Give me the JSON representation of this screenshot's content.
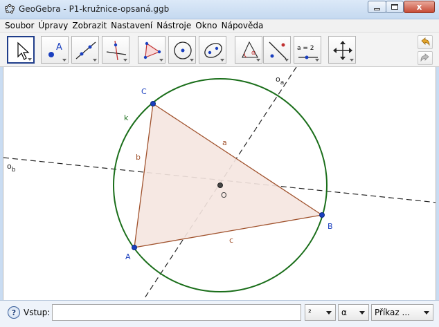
{
  "window": {
    "title": "GeoGebra - P1-kružnice-opsaná.ggb",
    "close_glyph": "x"
  },
  "menu": [
    "Soubor",
    "Úpravy",
    "Zobrazit",
    "Nastavení",
    "Nástroje",
    "Okno",
    "Nápověda"
  ],
  "toolbar": {
    "tools": [
      {
        "name": "move-tool",
        "icon": "cursor-arrow-icon",
        "active": true
      },
      {
        "name": "point-tool",
        "icon": "point-a-icon",
        "active": false
      },
      {
        "name": "line-tool",
        "icon": "line-icon",
        "active": false
      },
      {
        "name": "perpendicular-line-tool",
        "icon": "perpendicular-line-icon",
        "active": false
      },
      {
        "name": "polygon-tool",
        "icon": "polygon-icon",
        "active": false
      },
      {
        "name": "circle-center-point-tool",
        "icon": "circle-center-icon",
        "active": false
      },
      {
        "name": "conic-tool",
        "icon": "ellipse-icon",
        "active": false
      },
      {
        "name": "angle-tool",
        "icon": "angle-icon",
        "active": false
      },
      {
        "name": "reflect-tool",
        "icon": "reflect-icon",
        "active": false
      },
      {
        "name": "slider-tool",
        "icon": "slider-icon",
        "label": "a = 2",
        "active": false
      },
      {
        "name": "move-graphics-tool",
        "icon": "move-cross-icon",
        "active": false
      }
    ],
    "undo_icon": "undo-icon",
    "redo_icon": "redo-icon"
  },
  "canvas": {
    "labels": {
      "A": "A",
      "B": "B",
      "C": "C",
      "O": "O",
      "a": "a",
      "b": "b",
      "c": "c",
      "k": "k",
      "oa_main": "o",
      "oa_sub": "a",
      "ob_main": "o",
      "ob_sub": "b"
    },
    "colors": {
      "circle": "#1a6e1a",
      "triangle_edge": "#a0522d",
      "triangle_fill": "#f5e6e0",
      "point": "#1a3fbf",
      "center_point": "#444444",
      "label_blue": "#1a3fbf",
      "label_brown": "#a0522d",
      "label_green": "#1a6e1a",
      "dashed_line": "#222222"
    }
  },
  "input_bar": {
    "label": "Vstup:",
    "value": "",
    "placeholder": "",
    "superscript_dropdown": "²",
    "greek_dropdown": "α",
    "command_dropdown": "Příkaz ..."
  }
}
